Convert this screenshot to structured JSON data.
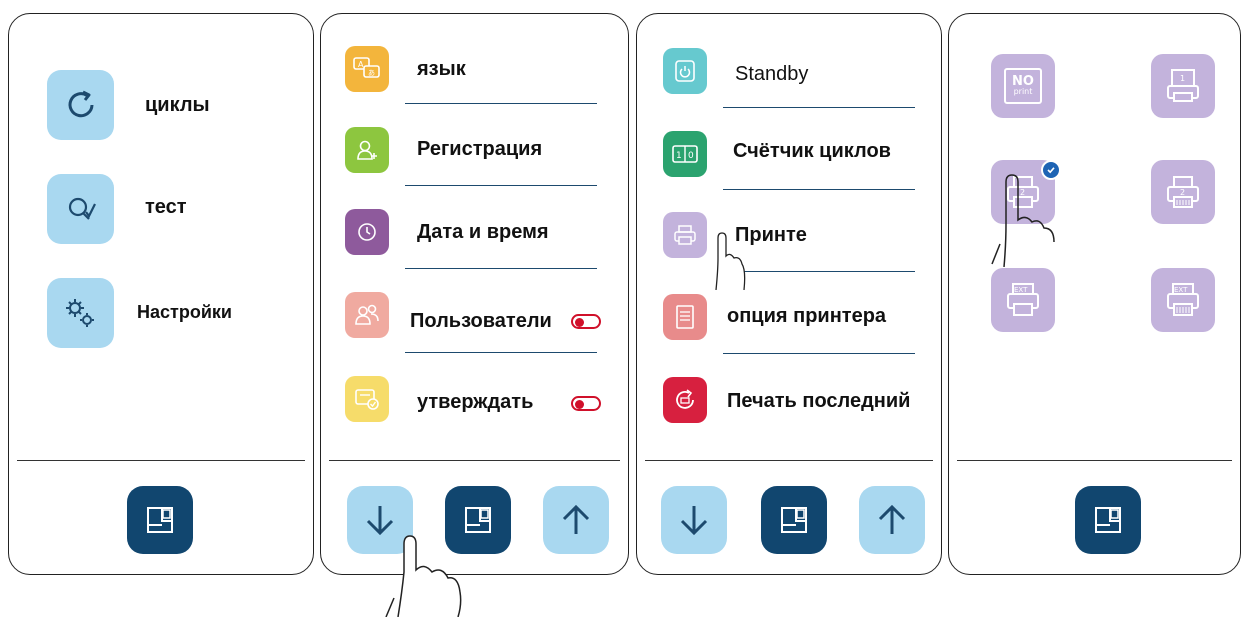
{
  "panels": {
    "main": {
      "items": [
        {
          "label": "циклы",
          "icon": "refresh-icon"
        },
        {
          "label": "тест",
          "icon": "search-check-icon"
        },
        {
          "label": "Настройки",
          "icon": "gears-icon"
        }
      ],
      "footer": {
        "home_icon": "home-panel-icon"
      }
    },
    "settings": {
      "items": [
        {
          "label": "язык",
          "icon": "translate-icon",
          "color": "#f3b53c"
        },
        {
          "label": "Регистрация",
          "icon": "user-add-icon",
          "color": "#8dc63f"
        },
        {
          "label": "Дата и время",
          "icon": "clock-icon",
          "color": "#8e5a9c"
        },
        {
          "label": "Пользователи",
          "icon": "users-icon",
          "color": "#f0aaa0",
          "toggle": "on"
        },
        {
          "label": "утверждать",
          "icon": "approve-icon",
          "color": "#f6dc6a",
          "toggle": "on"
        }
      ],
      "footer": {
        "down_icon": "arrow-down-icon",
        "home_icon": "home-panel-icon",
        "up_icon": "arrow-up-icon"
      }
    },
    "printer_settings": {
      "items": [
        {
          "label": "Standby",
          "icon": "power-icon",
          "color": "#66c9cf"
        },
        {
          "label": "Счётчик циклов",
          "icon": "counter-icon",
          "color": "#2ba36f"
        },
        {
          "label": "Принте",
          "icon": "printer-icon",
          "color": "#c3b3dc"
        },
        {
          "label": "опция принтера",
          "icon": "document-icon",
          "color": "#e88b8b"
        },
        {
          "label": "Печать последний",
          "icon": "reprint-icon",
          "color": "#d7203f"
        }
      ],
      "footer": {
        "down_icon": "arrow-down-icon",
        "home_icon": "home-panel-icon",
        "up_icon": "arrow-up-icon"
      }
    },
    "printer_select": {
      "options": [
        {
          "label": "NO",
          "sublabel": "print",
          "icon": "no-print-icon"
        },
        {
          "label": "1",
          "icon": "printer-1-icon"
        },
        {
          "label": "2",
          "icon": "printer-2-icon",
          "selected": true
        },
        {
          "label": "2",
          "icon": "printer-2-wide-icon"
        },
        {
          "label": "EXT",
          "icon": "printer-ext-icon"
        },
        {
          "label": "EXT",
          "icon": "printer-ext-wide-icon"
        }
      ],
      "footer": {
        "home_icon": "home-panel-icon"
      }
    }
  },
  "colors": {
    "nav_dark": "#11466f",
    "nav_light": "#a9d8f0",
    "tile_purple": "#c3b3dc",
    "toggle_red": "#d0102a",
    "check_blue": "#1e64b4"
  }
}
